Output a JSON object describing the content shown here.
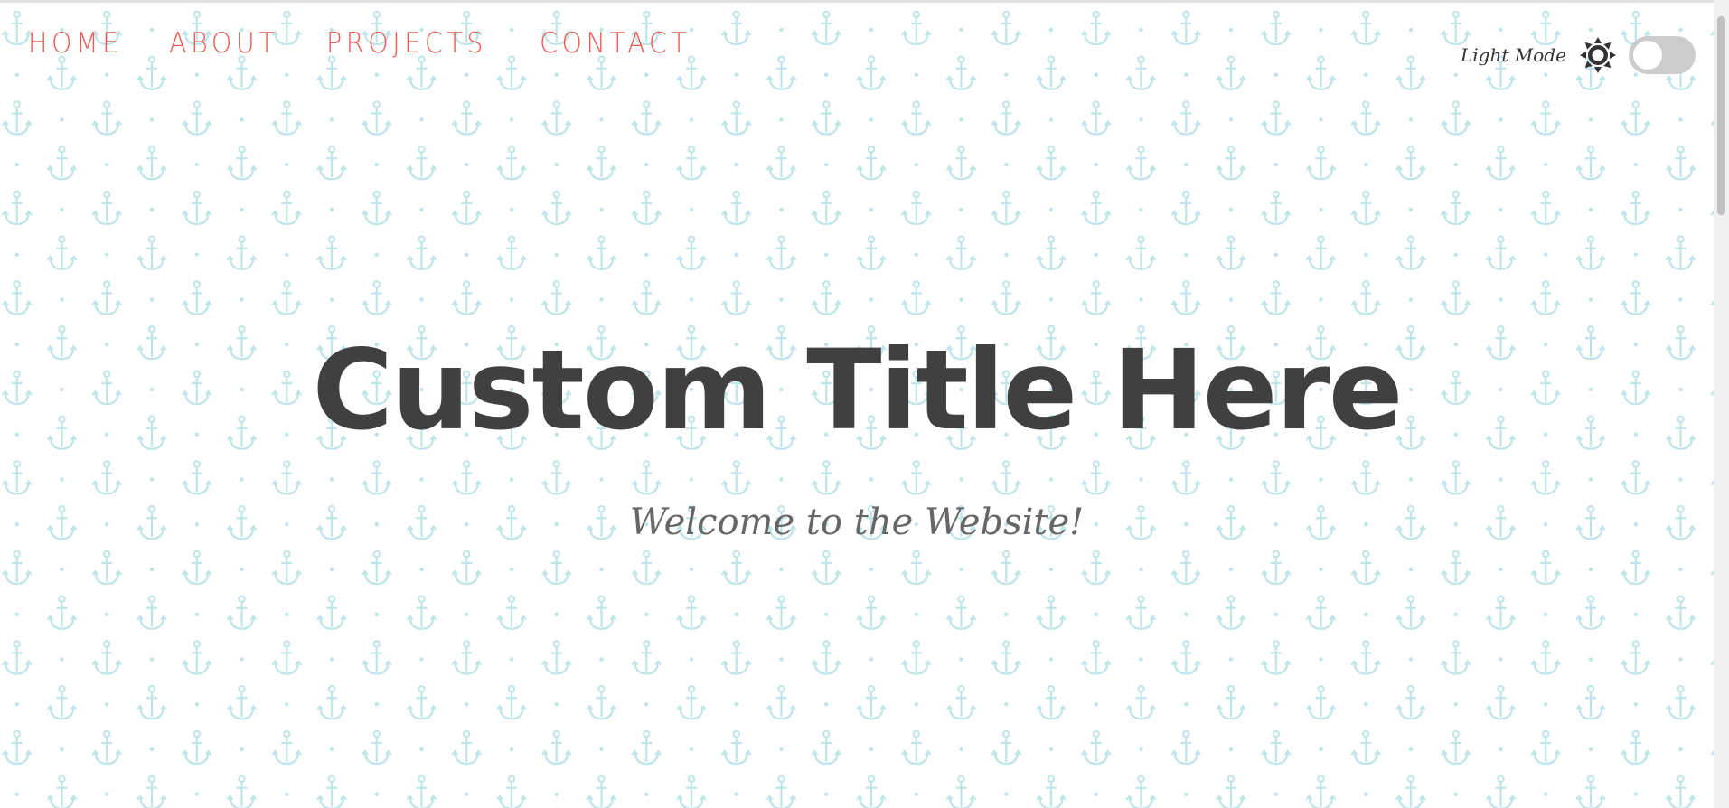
{
  "nav": {
    "links": [
      "HOME",
      "ABOUT",
      "PROJECTS",
      "CONTACT"
    ]
  },
  "theme": {
    "mode_label": "Light Mode",
    "icon": "sun-icon",
    "toggle_on": false
  },
  "hero": {
    "title": "Custom Title Here",
    "subtitle": "Welcome to the Website!"
  },
  "colors": {
    "nav_link": "#ef5a55",
    "title": "#404040",
    "subtitle": "#666666",
    "pattern": "#bfe5e8",
    "toggle_track": "#cccccc"
  },
  "background": {
    "pattern_icon": "anchor-icon"
  }
}
